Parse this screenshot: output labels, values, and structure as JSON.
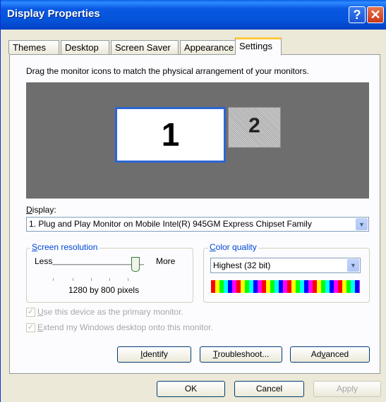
{
  "window": {
    "title": "Display Properties"
  },
  "tabs": [
    "Themes",
    "Desktop",
    "Screen Saver",
    "Appearance",
    "Settings"
  ],
  "instruction": "Drag the monitor icons to match the physical arrangement of your monitors.",
  "monitors": {
    "primary": "1",
    "secondary": "2"
  },
  "display": {
    "label": "Display:",
    "value": "1. Plug and Play Monitor on Mobile Intel(R) 945GM Express Chipset Family"
  },
  "resolution": {
    "group_label": "Screen resolution",
    "less": "Less",
    "more": "More",
    "value": "1280 by 800 pixels"
  },
  "color_quality": {
    "group_label": "Color quality",
    "value": "Highest (32 bit)"
  },
  "checkboxes": {
    "primary": "Use this device as the primary monitor.",
    "extend": "Extend my Windows desktop onto this monitor."
  },
  "buttons": {
    "identify": "Identify",
    "troubleshoot": "Troubleshoot...",
    "advanced": "Advanced",
    "ok": "OK",
    "cancel": "Cancel",
    "apply": "Apply"
  },
  "icons": {
    "help": "help-icon",
    "close": "close-icon",
    "dropdown": "chevron-down-icon",
    "check": "checkmark-icon"
  }
}
